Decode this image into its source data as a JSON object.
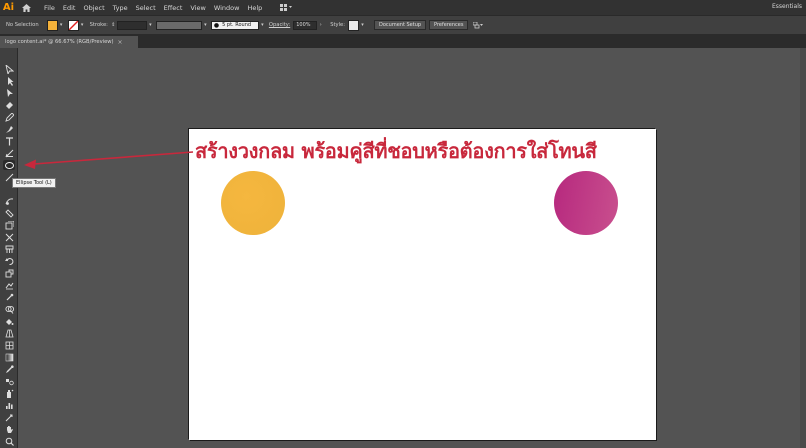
{
  "app": {
    "logo": "Ai",
    "menu": [
      "File",
      "Edit",
      "Object",
      "Type",
      "Select",
      "Effect",
      "View",
      "Window",
      "Help"
    ],
    "workspace": "Essentials"
  },
  "control_bar": {
    "selection": "No Selection",
    "stroke_label": "Stroke:",
    "brush": "5 pt. Round",
    "opacity_label": "Opacity:",
    "opacity_value": "100%",
    "style_label": "Style:",
    "document_setup": "Document Setup",
    "preferences": "Preferences",
    "fill_color": "#f5b23a"
  },
  "document_tab": {
    "title": "logo content.ai* @ 66.67% (RGB/Preview)",
    "close": "×"
  },
  "tooltip": "Ellipse Tool (L)",
  "artboard": {
    "annotation": "สร้างวงกลม พร้อมคู่สีที่ชอบหรือต้องการใส่โทนสี",
    "annotation_color": "#c8283c",
    "circle_left": {
      "from": "#f5b73f",
      "to": "#eeb23a"
    },
    "circle_right": {
      "from": "#b6287e",
      "to": "#c9508e"
    }
  },
  "tools": [
    "selection-tool-icon",
    "direct-selection-tool-icon",
    "magic-wand-icon",
    "lasso-icon",
    "pen-tool-icon",
    "curvature-icon",
    "type-tool-icon",
    "line-segment-icon",
    "ellipse-tool-icon",
    "paintbrush-icon",
    "shaper-icon",
    "eraser-icon",
    "rotate-icon",
    "scale-icon",
    "width-icon",
    "free-transform-icon",
    "shape-builder-icon",
    "perspective-icon",
    "mesh-icon",
    "gradient-icon",
    "eyedropper-icon",
    "blend-icon",
    "symbol-sprayer-icon",
    "column-graph-icon",
    "artboard-tool-icon",
    "slice-icon",
    "hand-tool-icon",
    "zoom-tool-icon"
  ]
}
